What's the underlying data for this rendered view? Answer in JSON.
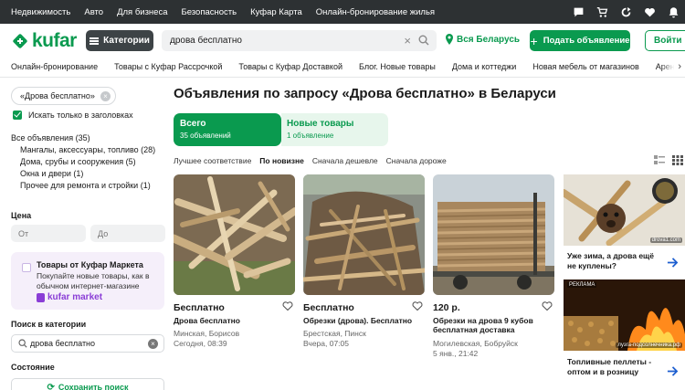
{
  "topbar": {
    "links": [
      "Недвижимость",
      "Авто",
      "Для бизнеса",
      "Безопасность",
      "Куфар Карта",
      "Онлайн-бронирование жилья"
    ]
  },
  "header": {
    "logo": "kufar",
    "categories_button": "Категории",
    "search_value": "дрова бесплатно",
    "location": "Вся Беларусь",
    "post_button": "Подать объявление",
    "login_button": "Войти"
  },
  "nav": {
    "links": [
      "Онлайн-бронирование",
      "Товары с Куфар Рассрочкой",
      "Товары с Куфар Доставкой",
      "Блог. Новые товары",
      "Дома и коттеджи",
      "Новая мебель от магазинов",
      "Аренда квартир"
    ]
  },
  "sidebar": {
    "chip": "«Дрова бесплатно»",
    "only_titles": "Искать только в заголовках",
    "all_ads": "Все объявления (35)",
    "categories": [
      "Мангалы, аксессуары, топливо (28)",
      "Дома, срубы и сооружения (5)",
      "Окна и двери (1)",
      "Прочее для ремонта и стройки (1)"
    ],
    "price_title": "Цена",
    "price_from": "От",
    "price_to": "До",
    "market": {
      "title": "Товары от Куфар Маркета",
      "desc": "Покупайте новые товары, как в обычном интернет-магазине",
      "logo": "kufar market"
    },
    "cat_search_title": "Поиск в категории",
    "cat_search_value": "дрова бесплатно",
    "state_title": "Состояние",
    "save_search": "Сохранить поиск"
  },
  "main": {
    "title": "Объявления по запросу «Дрова бесплатно» в Беларуси",
    "tabs": [
      {
        "label": "Всего",
        "count": "35 объявлений"
      },
      {
        "label": "Новые товары",
        "count": "1 объявление"
      }
    ],
    "sort": [
      "Лучшее соответствие",
      "По новизне",
      "Сначала дешевле",
      "Сначала дороже"
    ],
    "listings": [
      {
        "price": "Бесплатно",
        "title": "Дрова бесплатно",
        "location": "Минская, Борисов",
        "date": "Сегодня, 08:39"
      },
      {
        "price": "Бесплатно",
        "title": "Обрезки (дрова). Бесплатно",
        "location": "Брестская, Пинск",
        "date": "Вчера, 07:05"
      },
      {
        "price": "120 р.",
        "title": "Обрезки на дрова 9 кубов бесплатная доставка",
        "location": "Могилевская, Бобруйск",
        "date": "5 янв., 21:42"
      }
    ],
    "ads": [
      {
        "text": "Уже зима, а дрова ещё не куплены?",
        "watermark": "drova1.com"
      },
      {
        "text": "Топливные пеллеты - оптом и в розницу",
        "badge": "РЕКЛАМА",
        "watermark": "лузга-подсолнечника.рф"
      }
    ]
  },
  "colors": {
    "brand": "#0a9a4f",
    "topbar": "#2d3133",
    "market": "#8a3dd6"
  }
}
